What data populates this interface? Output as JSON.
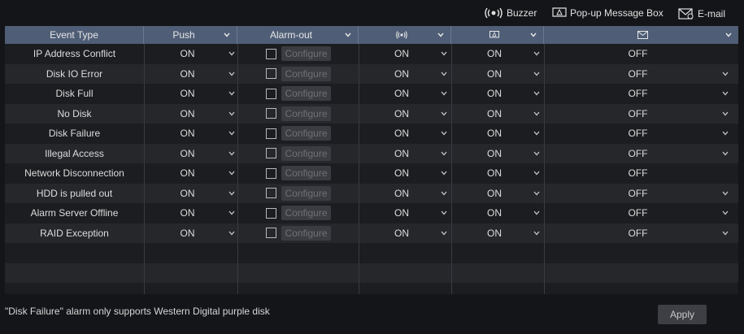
{
  "legend": {
    "buzzer_label": "Buzzer",
    "popup_label": "Pop-up Message Box",
    "email_label": "E-mail"
  },
  "columns": {
    "event_type": "Event Type",
    "push": "Push",
    "alarm_out": "Alarm-out"
  },
  "configure_label": "Configure",
  "rows": [
    {
      "event": "IP Address Conflict",
      "push": "ON",
      "buzzer": "ON",
      "popup": "ON",
      "email": "OFF",
      "email_dropdown": false
    },
    {
      "event": "Disk IO Error",
      "push": "ON",
      "buzzer": "ON",
      "popup": "ON",
      "email": "OFF",
      "email_dropdown": true
    },
    {
      "event": "Disk Full",
      "push": "ON",
      "buzzer": "ON",
      "popup": "ON",
      "email": "OFF",
      "email_dropdown": true
    },
    {
      "event": "No Disk",
      "push": "ON",
      "buzzer": "ON",
      "popup": "ON",
      "email": "OFF",
      "email_dropdown": true
    },
    {
      "event": "Disk Failure",
      "push": "ON",
      "buzzer": "ON",
      "popup": "ON",
      "email": "OFF",
      "email_dropdown": true
    },
    {
      "event": "Illegal Access",
      "push": "ON",
      "buzzer": "ON",
      "popup": "ON",
      "email": "OFF",
      "email_dropdown": true
    },
    {
      "event": "Network Disconnection",
      "push": "ON",
      "buzzer": "ON",
      "popup": "ON",
      "email": "OFF",
      "email_dropdown": false
    },
    {
      "event": "HDD is pulled out",
      "push": "ON",
      "buzzer": "ON",
      "popup": "ON",
      "email": "OFF",
      "email_dropdown": true
    },
    {
      "event": "Alarm Server Offline",
      "push": "ON",
      "buzzer": "ON",
      "popup": "ON",
      "email": "OFF",
      "email_dropdown": true
    },
    {
      "event": "RAID Exception",
      "push": "ON",
      "buzzer": "ON",
      "popup": "ON",
      "email": "OFF",
      "email_dropdown": true
    }
  ],
  "footer": {
    "note": "\"Disk Failure\" alarm only supports Western Digital purple disk",
    "apply_label": "Apply"
  },
  "colors": {
    "header_bg": "#4f5e76",
    "page_bg": "#141518"
  }
}
